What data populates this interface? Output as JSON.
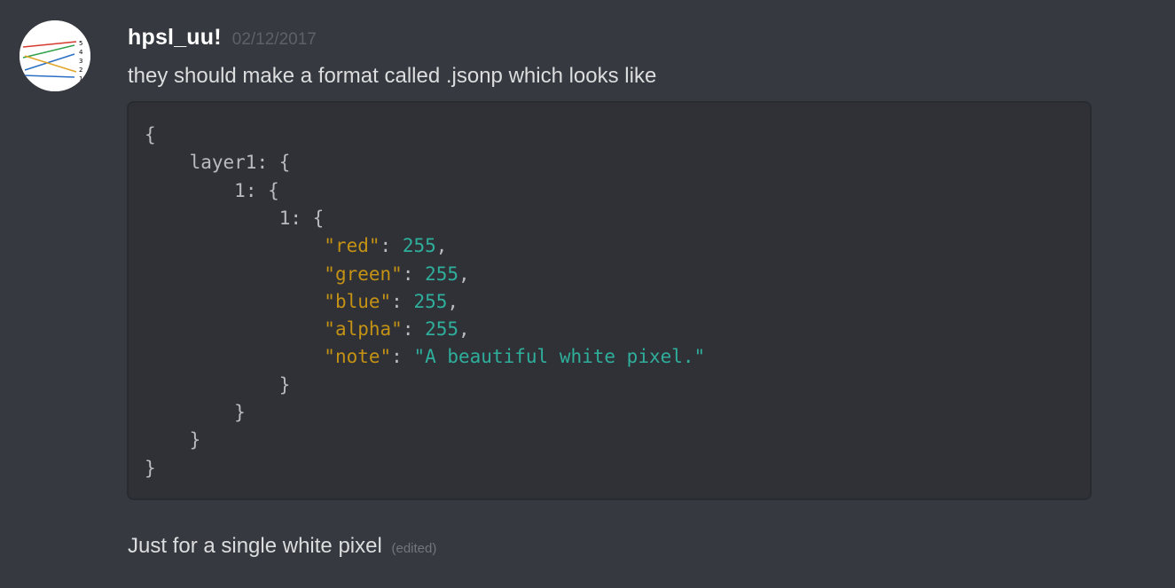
{
  "message": {
    "author": "hpsl_uu!",
    "timestamp": "02/12/2017",
    "text_1": "they should make a format called .jsonp which looks like",
    "text_2": "Just for a single white pixel",
    "edited_label": "(edited)"
  },
  "code": {
    "lines": [
      {
        "indent": "",
        "parts": [
          {
            "t": "{",
            "c": "punct"
          }
        ]
      },
      {
        "indent": "    ",
        "parts": [
          {
            "t": "layer1",
            "c": "plain"
          },
          {
            "t": ": {",
            "c": "punct"
          }
        ]
      },
      {
        "indent": "        ",
        "parts": [
          {
            "t": "1",
            "c": "plain"
          },
          {
            "t": ": {",
            "c": "punct"
          }
        ]
      },
      {
        "indent": "            ",
        "parts": [
          {
            "t": "1",
            "c": "plain"
          },
          {
            "t": ": {",
            "c": "punct"
          }
        ]
      },
      {
        "indent": "                ",
        "parts": [
          {
            "t": "\"red\"",
            "c": "key"
          },
          {
            "t": ": ",
            "c": "punct"
          },
          {
            "t": "255",
            "c": "num"
          },
          {
            "t": ",",
            "c": "punct"
          }
        ]
      },
      {
        "indent": "                ",
        "parts": [
          {
            "t": "\"green\"",
            "c": "key"
          },
          {
            "t": ": ",
            "c": "punct"
          },
          {
            "t": "255",
            "c": "num"
          },
          {
            "t": ",",
            "c": "punct"
          }
        ]
      },
      {
        "indent": "                ",
        "parts": [
          {
            "t": "\"blue\"",
            "c": "key"
          },
          {
            "t": ": ",
            "c": "punct"
          },
          {
            "t": "255",
            "c": "num"
          },
          {
            "t": ",",
            "c": "punct"
          }
        ]
      },
      {
        "indent": "                ",
        "parts": [
          {
            "t": "\"alpha\"",
            "c": "key"
          },
          {
            "t": ": ",
            "c": "punct"
          },
          {
            "t": "255",
            "c": "num"
          },
          {
            "t": ",",
            "c": "punct"
          }
        ]
      },
      {
        "indent": "                ",
        "parts": [
          {
            "t": "\"note\"",
            "c": "key"
          },
          {
            "t": ": ",
            "c": "punct"
          },
          {
            "t": "\"A beautiful white pixel.\"",
            "c": "str"
          }
        ]
      },
      {
        "indent": "            ",
        "parts": [
          {
            "t": "}",
            "c": "punct"
          }
        ]
      },
      {
        "indent": "        ",
        "parts": [
          {
            "t": "}",
            "c": "punct"
          }
        ]
      },
      {
        "indent": "    ",
        "parts": [
          {
            "t": "}",
            "c": "punct"
          }
        ]
      },
      {
        "indent": "",
        "parts": [
          {
            "t": "}",
            "c": "punct"
          }
        ]
      }
    ]
  },
  "avatar": {
    "icon": "avatar-graph-icon"
  },
  "colors": {
    "background": "#36393f",
    "code_background": "#2f3136",
    "username": "#ffffff",
    "timestamp": "#5e6167",
    "text": "#dcddde",
    "code_key": "#c49214",
    "code_value": "#2fae9c",
    "code_punct": "#b9bbbe"
  }
}
